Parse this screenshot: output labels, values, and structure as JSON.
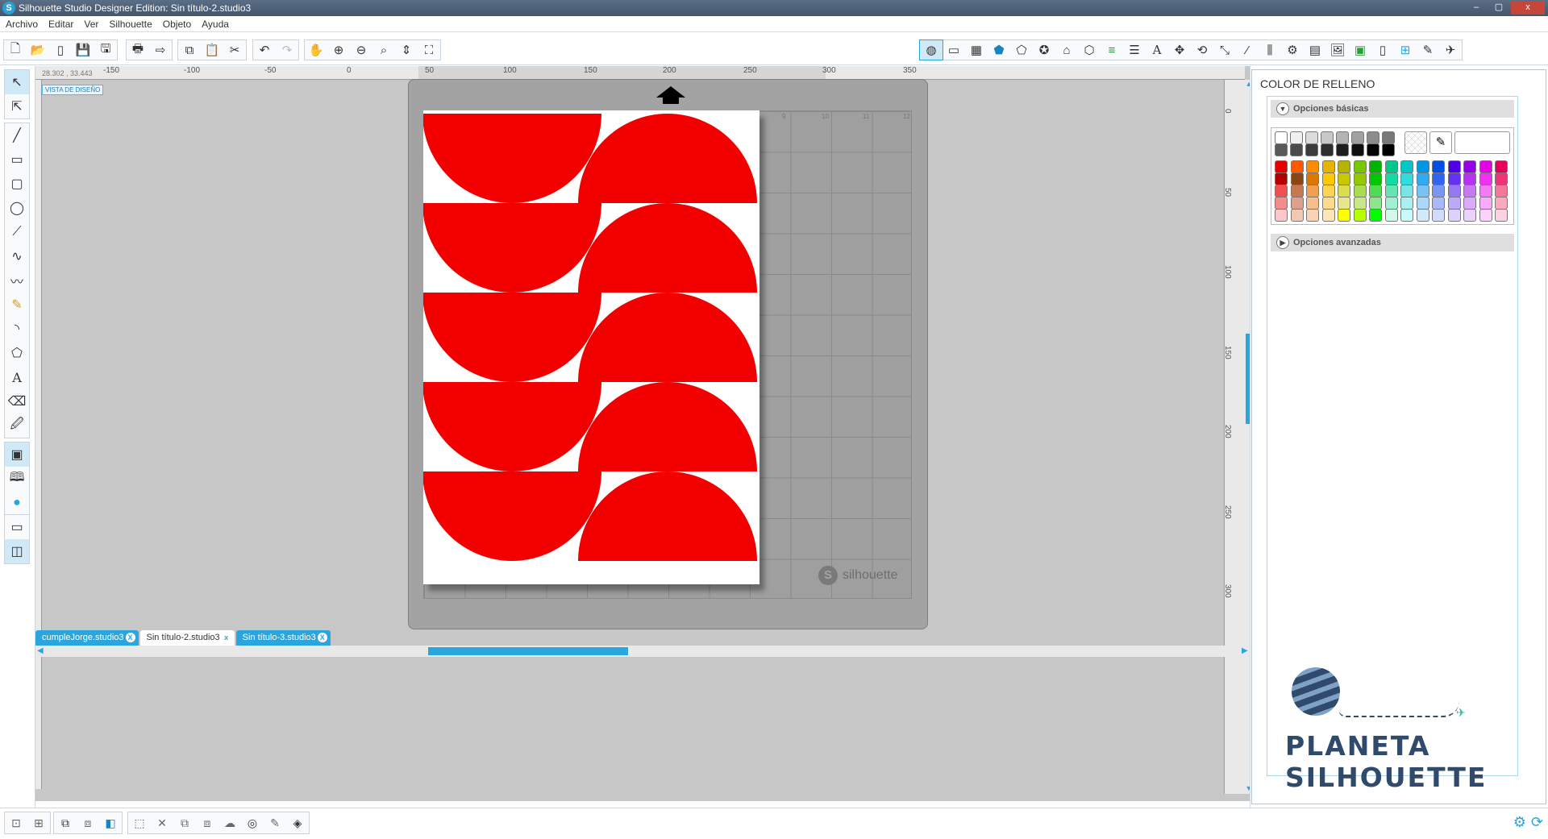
{
  "window": {
    "title": "Silhouette Studio Designer Edition: Sin título-2.studio3",
    "app_icon": "S",
    "controls": [
      "–",
      "▢",
      "x"
    ]
  },
  "menu": [
    "Archivo",
    "Editar",
    "Ver",
    "Silhouette",
    "Objeto",
    "Ayuda"
  ],
  "design": {
    "coords": "28.302 , 33.443",
    "view_label": "VISTA DE DISEÑO",
    "ruler_top": [
      "-150",
      "-100",
      "-50",
      "0",
      "50",
      "100",
      "150",
      "200",
      "250",
      "300",
      "350"
    ],
    "ruler_right": [
      "0",
      "50",
      "100",
      "150",
      "200",
      "250",
      "300"
    ],
    "grid_numbers": [
      "9",
      "10",
      "11",
      "12"
    ],
    "mat_brand": "silhouette",
    "mat_brand_icon": "S",
    "shape_color": "#f20000",
    "shapes": [
      {
        "row": 1,
        "left": "semicircle-down",
        "right": "semicircle-up"
      },
      {
        "row": 2,
        "left": "semicircle-down",
        "right": "semicircle-up"
      },
      {
        "row": 3,
        "left": "semicircle-down",
        "right": "semicircle-up"
      },
      {
        "row": 4,
        "left": "semicircle-down",
        "right": "semicircle-up"
      },
      {
        "row": 5,
        "left": "semicircle-down",
        "right": "semicircle-up"
      }
    ]
  },
  "tabs": [
    {
      "label": "cumpleJorge.studio3",
      "close": "X",
      "selected": false
    },
    {
      "label": "Sin título-2.studio3",
      "close": "x",
      "selected": true
    },
    {
      "label": "Sin título-3.studio3",
      "close": "X",
      "selected": false
    }
  ],
  "panel": {
    "title": "COLOR DE RELLENO",
    "basic_options": "Opciones básicas",
    "advanced_options": "Opciones avanzadas",
    "basic_icon": "chevron-down-icon",
    "advanced_icon": "play-icon",
    "grays": [
      "#ffffff",
      "#f0f0f0",
      "#dcdcdc",
      "#c8c8c8",
      "#b4b4b4",
      "#a0a0a0",
      "#8c8c8c",
      "#787878",
      "#5a5a5a",
      "#4b4b4b",
      "#3c3c3c",
      "#2d2d2d",
      "#1e1e1e",
      "#0f0f0f",
      "#050505",
      "#000000"
    ],
    "palette": [
      [
        "#e60000",
        "#ff5a00",
        "#ff8c00",
        "#e6b400",
        "#b4b400",
        "#78c800",
        "#00b400",
        "#00c88c",
        "#00c8c8",
        "#0096e6",
        "#0050e6",
        "#5000e6",
        "#9600e6",
        "#e600e6",
        "#e6005a"
      ],
      [
        "#b40000",
        "#8c4614",
        "#dc7800",
        "#ffc800",
        "#c8c800",
        "#96c800",
        "#00c800",
        "#14dca0",
        "#32dcdc",
        "#32aaf0",
        "#3264f0",
        "#6432f0",
        "#b432f0",
        "#f032f0",
        "#f03278"
      ],
      [
        "#f05050",
        "#c87850",
        "#f0a050",
        "#ffd250",
        "#dcdc50",
        "#aadc50",
        "#50dc50",
        "#64e6b4",
        "#78e6e6",
        "#78c3f5",
        "#7896f5",
        "#9678f5",
        "#c878f5",
        "#f578f5",
        "#f5789b"
      ],
      [
        "#f58c8c",
        "#dca08c",
        "#f5be8c",
        "#ffdc8c",
        "#e6e68c",
        "#c8e68c",
        "#8ce68c",
        "#a0f0d2",
        "#aaf0f0",
        "#aad7fa",
        "#aab9fa",
        "#b9aafa",
        "#dcaafa",
        "#faaafa",
        "#faaabe"
      ],
      [
        "#fac8c8",
        "#f0c8b4",
        "#fad2b4",
        "#ffe6b4",
        "#ffff00",
        "#b4ff00",
        "#00ff00",
        "#d2faeb",
        "#c8fafa",
        "#d2ebfc",
        "#d2dcfc",
        "#dcd2fc",
        "#ebd2fc",
        "#fcd2fc",
        "#fcd2e1"
      ]
    ]
  },
  "logo": {
    "text": "PLANETA SILHOUETTE",
    "icon": "planet-icon"
  },
  "toolbar": {
    "file_icons": [
      "new-file-icon",
      "open-icon",
      "library-icon",
      "save-icon",
      "save-as-icon"
    ],
    "print_icons": [
      "print-icon",
      "send-icon"
    ],
    "edit_icons": [
      "copy-icon",
      "paste-icon",
      "cut-icon"
    ],
    "history_icons": [
      "undo-icon",
      "redo-icon"
    ],
    "zoom_icons": [
      "pan-icon",
      "zoom-in-icon",
      "zoom-out-icon",
      "zoom-select-icon",
      "fit-page-icon",
      "fit-window-icon"
    ],
    "panel_icons": [
      "fill-color-icon",
      "line-color-icon",
      "fill-pattern-icon",
      "shape-pentagon-icon",
      "offset-icon",
      "replicate-icon",
      "modify-icon",
      "transform-icon",
      "line-style-icon",
      "align-icon",
      "text-icon",
      "point-edit-icon",
      "rotate-icon",
      "scale-icon",
      "knife-icon",
      "split-icon",
      "trace-icon",
      "page-setup-icon",
      "design-store-icon",
      "library-panel-icon",
      "image-icon",
      "grid-icon",
      "cut-settings-icon",
      "send-to-silhouette-icon"
    ]
  }
}
